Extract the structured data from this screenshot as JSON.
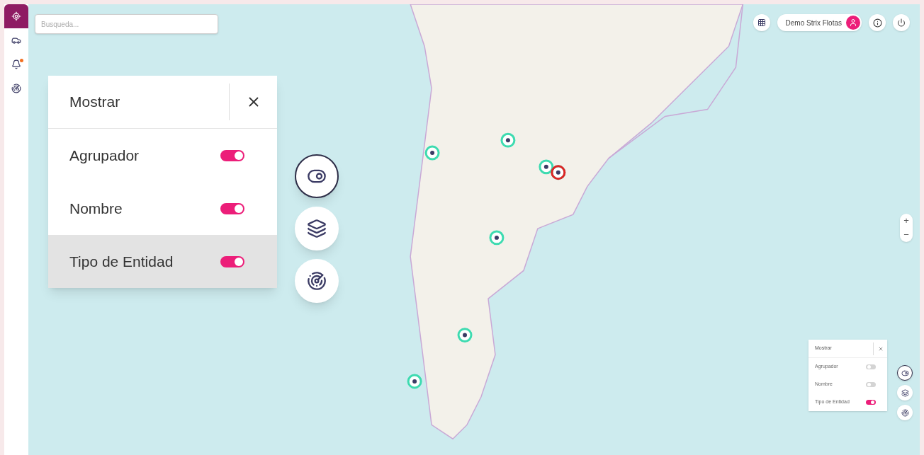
{
  "sidebar": {
    "items": [
      {
        "kind": "locate",
        "selected": true,
        "alert": false
      },
      {
        "kind": "vehicle",
        "selected": false,
        "alert": false
      },
      {
        "kind": "alerts",
        "selected": false,
        "alert": true
      },
      {
        "kind": "radar",
        "selected": false,
        "alert": false
      }
    ]
  },
  "search": {
    "placeholder": "Busqueda..."
  },
  "user": {
    "name": "Demo Strix Flotas"
  },
  "display_panel": {
    "title": "Mostrar",
    "options": [
      {
        "label": "Agrupador",
        "on": true,
        "selected": false
      },
      {
        "label": "Nombre",
        "on": true,
        "selected": false
      },
      {
        "label": "Tipo de Entidad",
        "on": true,
        "selected": true
      }
    ]
  },
  "map_tools": [
    {
      "kind": "toggle",
      "selected": true
    },
    {
      "kind": "layers",
      "selected": false
    },
    {
      "kind": "radar",
      "selected": false
    }
  ],
  "zoom": {
    "in": "+",
    "out": "−"
  },
  "inset_panel": {
    "title": "Mostrar",
    "options": [
      {
        "label": "Agrupador",
        "on": false
      },
      {
        "label": "Nombre",
        "on": false
      },
      {
        "label": "Tipo de Entidad",
        "on": true
      }
    ]
  }
}
